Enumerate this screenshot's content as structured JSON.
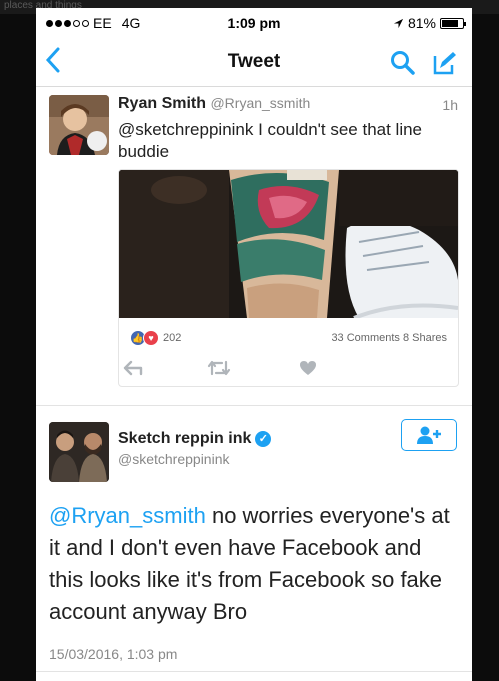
{
  "background_ghost_text": "places and things",
  "status_bar": {
    "carrier": "EE",
    "network": "4G",
    "time": "1:09 pm",
    "battery": "81%",
    "battery_level": 0.81,
    "location_icon": "location-arrow-icon"
  },
  "nav": {
    "title": "Tweet",
    "back_icon": "chevron-left-icon",
    "search_icon": "search-icon",
    "compose_icon": "compose-icon"
  },
  "tweet1": {
    "author_name": "Ryan Smith",
    "author_handle": "@Rryan_ssmith",
    "time": "1h",
    "text": "@sketchreppinink I couldn't see that line buddie",
    "card": {
      "reaction_count": "202",
      "stats": "33 Comments 8 Shares"
    },
    "actions": [
      "reply-icon",
      "retweet-icon",
      "heart-icon"
    ]
  },
  "tweet2": {
    "author_name": "Sketch reppin ink",
    "author_handle": "@sketchreppinink",
    "mention": "@Rryan_ssmith",
    "text": "no worries everyone's at it and I don't even have Facebook and this looks like it's from Facebook so fake account anyway Bro",
    "date": "15/03/2016, 1:03 pm",
    "follow_icon": "add-user-icon"
  },
  "colors": {
    "accent": "#1da1f2",
    "text": "#222222",
    "muted": "#888888"
  }
}
